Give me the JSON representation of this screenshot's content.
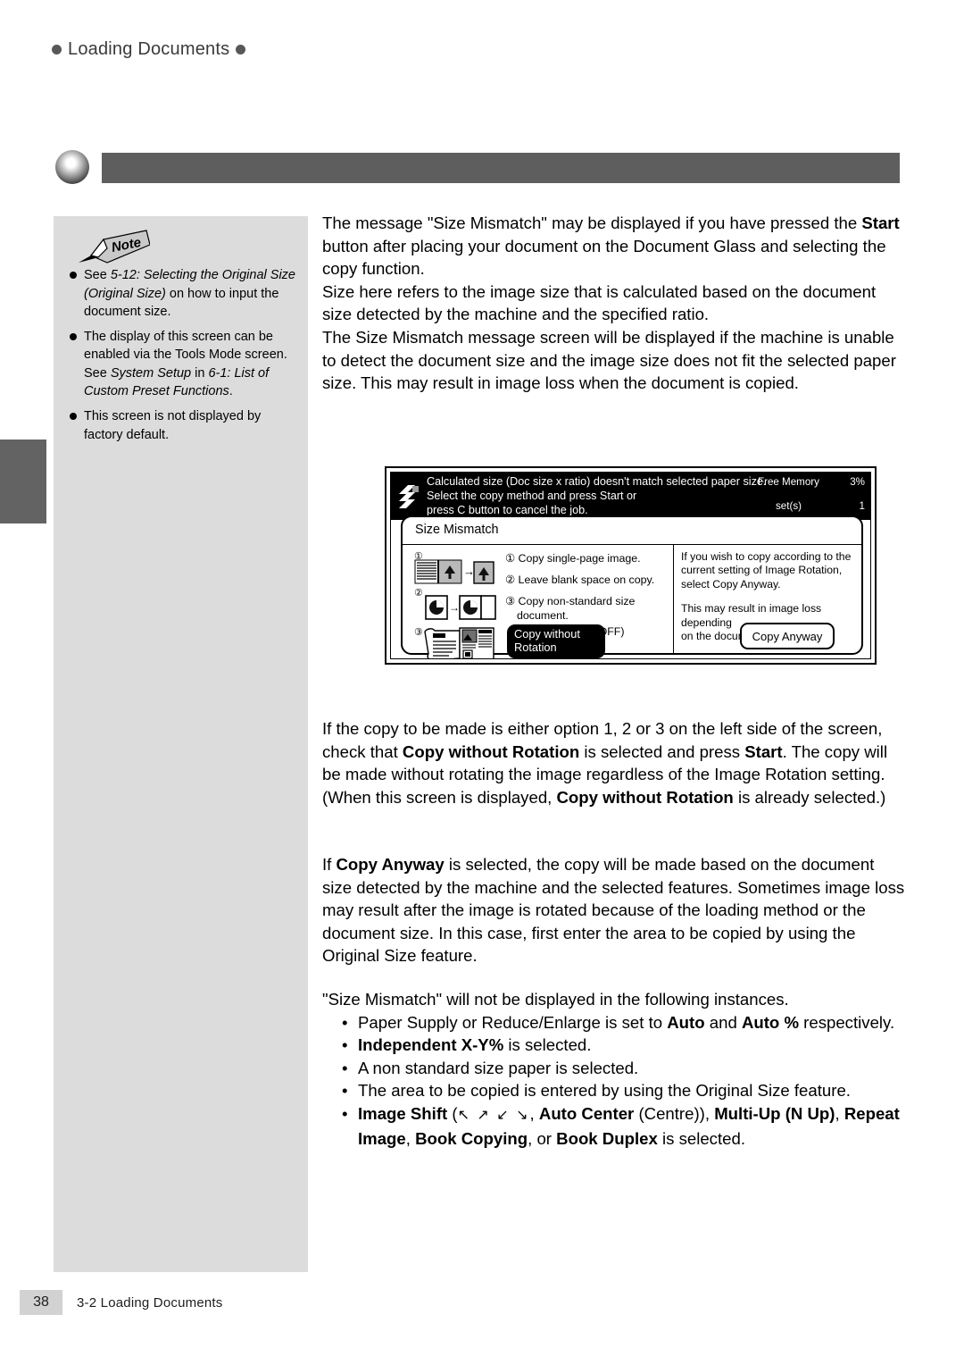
{
  "running_head": {
    "label": "Loading Documents",
    "dot_color": "#585858"
  },
  "note_panel": {
    "tag_label": "Note",
    "items": [
      {
        "parts": [
          {
            "text": "See ",
            "style": "normal"
          },
          {
            "text": "5-12: Selecting the Original Size (Original Size)",
            "style": "italic"
          },
          {
            "text": " on how to input the document size.",
            "style": "normal"
          }
        ]
      },
      {
        "parts": [
          {
            "text": "The display of this screen can be enabled via the Tools Mode screen. See ",
            "style": "normal"
          },
          {
            "text": "System Setup",
            "style": "italic"
          },
          {
            "text": " in ",
            "style": "normal"
          },
          {
            "text": "6-1: List of Custom Preset Functions",
            "style": "italic"
          },
          {
            "text": ".",
            "style": "normal"
          }
        ]
      },
      {
        "parts": [
          {
            "text": "This screen is not displayed by factory default.",
            "style": "normal"
          }
        ]
      }
    ]
  },
  "body": {
    "para1": {
      "s1": "The message \"Size Mismatch\" may be displayed if you have pressed the ",
      "bold1": "Start",
      "s2": " button after placing your document on the Document Glass and selecting the copy function."
    },
    "para2": "Size here refers to the image size that is calculated based on the document size detected by the machine and the specified ratio.",
    "para3": "The Size Mismatch message screen will be displayed if the machine is unable to detect the document size and the image size does not fit the selected paper size. This may result in image loss when the document is copied.",
    "para4": {
      "s1": "If the copy to be made is either option 1, 2 or 3 on the left side of the screen, check that ",
      "bold1": "Copy without Rotation",
      "s2": " is selected and press ",
      "bold2": "Start",
      "s3": ". The copy will be made without rotating the image regardless of the Image Rotation setting. (When this screen is displayed, ",
      "bold3": "Copy without Rotation",
      "s4": " is already selected.)"
    },
    "para5": {
      "s1": "If ",
      "bold1": "Copy Anyway",
      "s2": " is selected, the copy will be made based on the document size detected by the machine and the selected features. Sometimes image loss may result after the image is rotated because of the loading method or the document size. In this case, first enter the area to be copied by using the Original Size feature."
    },
    "para6": "\"Size Mismatch\" will not be displayed in the following instances.",
    "bullets": {
      "b1": {
        "s1": "Paper Supply or Reduce/Enlarge is set to ",
        "bold1": "Auto",
        "s2": " and ",
        "bold2": "Auto %",
        "s3": " respectively."
      },
      "b2": {
        "bold1": "Independent X-Y%",
        "s1": " is selected."
      },
      "b3": "A non standard size paper is selected.",
      "b4": "The area to be copied is entered by using the Original Size feature.",
      "b5": {
        "bold1": "Image Shift",
        "s1": " (",
        "arrows": "↖ ↗ ↙ ↘",
        "s2": ", ",
        "bold2": "Auto Center",
        "s3": " (Centre)), ",
        "bold3": "Multi-Up (N Up)",
        "s4": ", ",
        "bold4": "Repeat Image",
        "s5": ", ",
        "bold5": "Book Copying",
        "s6": ", or ",
        "bold6": "Book Duplex",
        "s7": " is selected."
      }
    }
  },
  "lcd": {
    "status_message_line1": "Calculated size (Doc size x ratio) doesn't match selected paper size.",
    "status_message_line2": "Select the copy method and press Start or",
    "status_message_line3": "press C button to cancel the job.",
    "free_memory_label": "Free Memory",
    "free_memory_value": "3%",
    "sets_label": "set(s)",
    "sets_value": "1",
    "dialog_title": "Size Mismatch",
    "options": [
      "① Copy single-page image.",
      "② Leave blank space on copy.",
      "③ Copy non-standard size",
      "document.",
      "(Image Rotation OFF)"
    ],
    "option_marks": [
      "①",
      "②",
      "③"
    ],
    "button_without_rotation_line1": "Copy without",
    "button_without_rotation_line2": "Rotation",
    "right_text_line1": "If you wish to copy according to the",
    "right_text_line2": "current setting of Image Rotation,",
    "right_text_line3": "select Copy Anyway.",
    "right_text_line4": "This may result in image loss depending",
    "right_text_line5": "on the document size.",
    "button_copy_anyway": "Copy Anyway"
  },
  "footer": {
    "page_number": "38",
    "section": "3-2  Loading Documents"
  }
}
